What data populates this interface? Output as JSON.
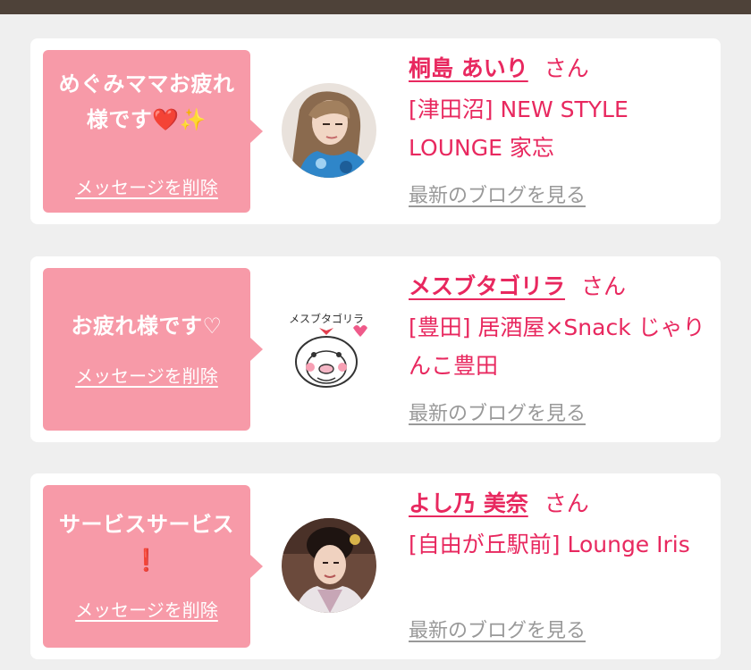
{
  "messages": [
    {
      "message_text": "めぐみママお疲れ様です",
      "message_emojis": [
        "❤️",
        "✨"
      ],
      "delete_label": "メッセージを削除",
      "user_name": "桐島 あいり",
      "honorific": "さん",
      "shop_area": "[津田沼]",
      "shop_name": "NEW STYLE LOUNGE 家忘",
      "blog_link": "最新のブログを見る",
      "avatar_icon": "avatar-photo-woman-blonde"
    },
    {
      "message_text": "お疲れ様です♡",
      "message_emojis": [],
      "delete_label": "メッセージを削除",
      "user_name": "メスブタゴリラ",
      "honorific": "さん",
      "shop_area": "[豊田]",
      "shop_name": "居酒屋×Snack じゃりんこ豊田",
      "blog_link": "最新のブログを見る",
      "avatar_icon": "avatar-gorilla-illustration",
      "avatar_caption": "メスブタゴリラ"
    },
    {
      "message_text": "サービスサービス",
      "message_emojis": [
        "❗"
      ],
      "delete_label": "メッセージを削除",
      "user_name": "よし乃 美奈",
      "honorific": "さん",
      "shop_area": "[自由が丘駅前]",
      "shop_name": "Lounge Iris",
      "blog_link": "最新のブログを見る",
      "avatar_icon": "avatar-photo-woman-kimono"
    }
  ],
  "colors": {
    "top_bar": "#4e4239",
    "background": "#efefef",
    "bubble": "#f79aa8",
    "accent_text": "#e8285f",
    "link_gray": "#999999"
  }
}
